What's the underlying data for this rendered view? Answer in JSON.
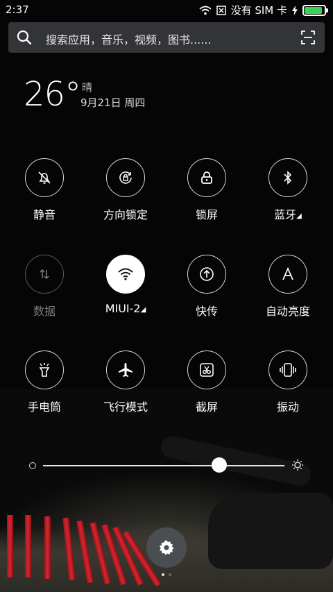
{
  "status_bar": {
    "time": "2:37",
    "sim_text": "没有 SIM 卡",
    "battery_level": 0.95,
    "icons": [
      "wifi-icon",
      "no-sim-icon",
      "charging-icon",
      "battery-icon"
    ]
  },
  "search": {
    "placeholder": "搜索应用，音乐，视频，图书......",
    "icons": [
      "search-icon",
      "scan-icon"
    ]
  },
  "weather": {
    "temperature": "26°",
    "condition": "晴",
    "date": "9月21日 周四"
  },
  "toggles": [
    {
      "label": "静音",
      "icon": "mute-icon",
      "state": "off"
    },
    {
      "label": "方向锁定",
      "icon": "rotation-lock-icon",
      "state": "off"
    },
    {
      "label": "锁屏",
      "icon": "lock-icon",
      "state": "off"
    },
    {
      "label": "蓝牙",
      "icon": "bluetooth-icon",
      "state": "off",
      "has_more": true
    },
    {
      "label": "数据",
      "icon": "mobile-data-icon",
      "state": "disabled"
    },
    {
      "label": "MIUI-2",
      "icon": "wifi-icon",
      "state": "on",
      "has_more": true
    },
    {
      "label": "快传",
      "icon": "quick-transfer-icon",
      "state": "off"
    },
    {
      "label": "自动亮度",
      "icon": "auto-brightness-icon",
      "state": "off"
    },
    {
      "label": "手电筒",
      "icon": "flashlight-icon",
      "state": "off"
    },
    {
      "label": "飞行模式",
      "icon": "airplane-icon",
      "state": "off"
    },
    {
      "label": "截屏",
      "icon": "screenshot-icon",
      "state": "off"
    },
    {
      "label": "振动",
      "icon": "vibrate-icon",
      "state": "off"
    }
  ],
  "brightness": {
    "level": 0.73
  },
  "settings_button": {
    "icon": "gear-icon"
  },
  "page_indicator": {
    "pages": 2,
    "current": 1
  },
  "colors": {
    "battery": "#39d353",
    "search_bg": "#333437",
    "settings_bg": "#4a4d52"
  }
}
